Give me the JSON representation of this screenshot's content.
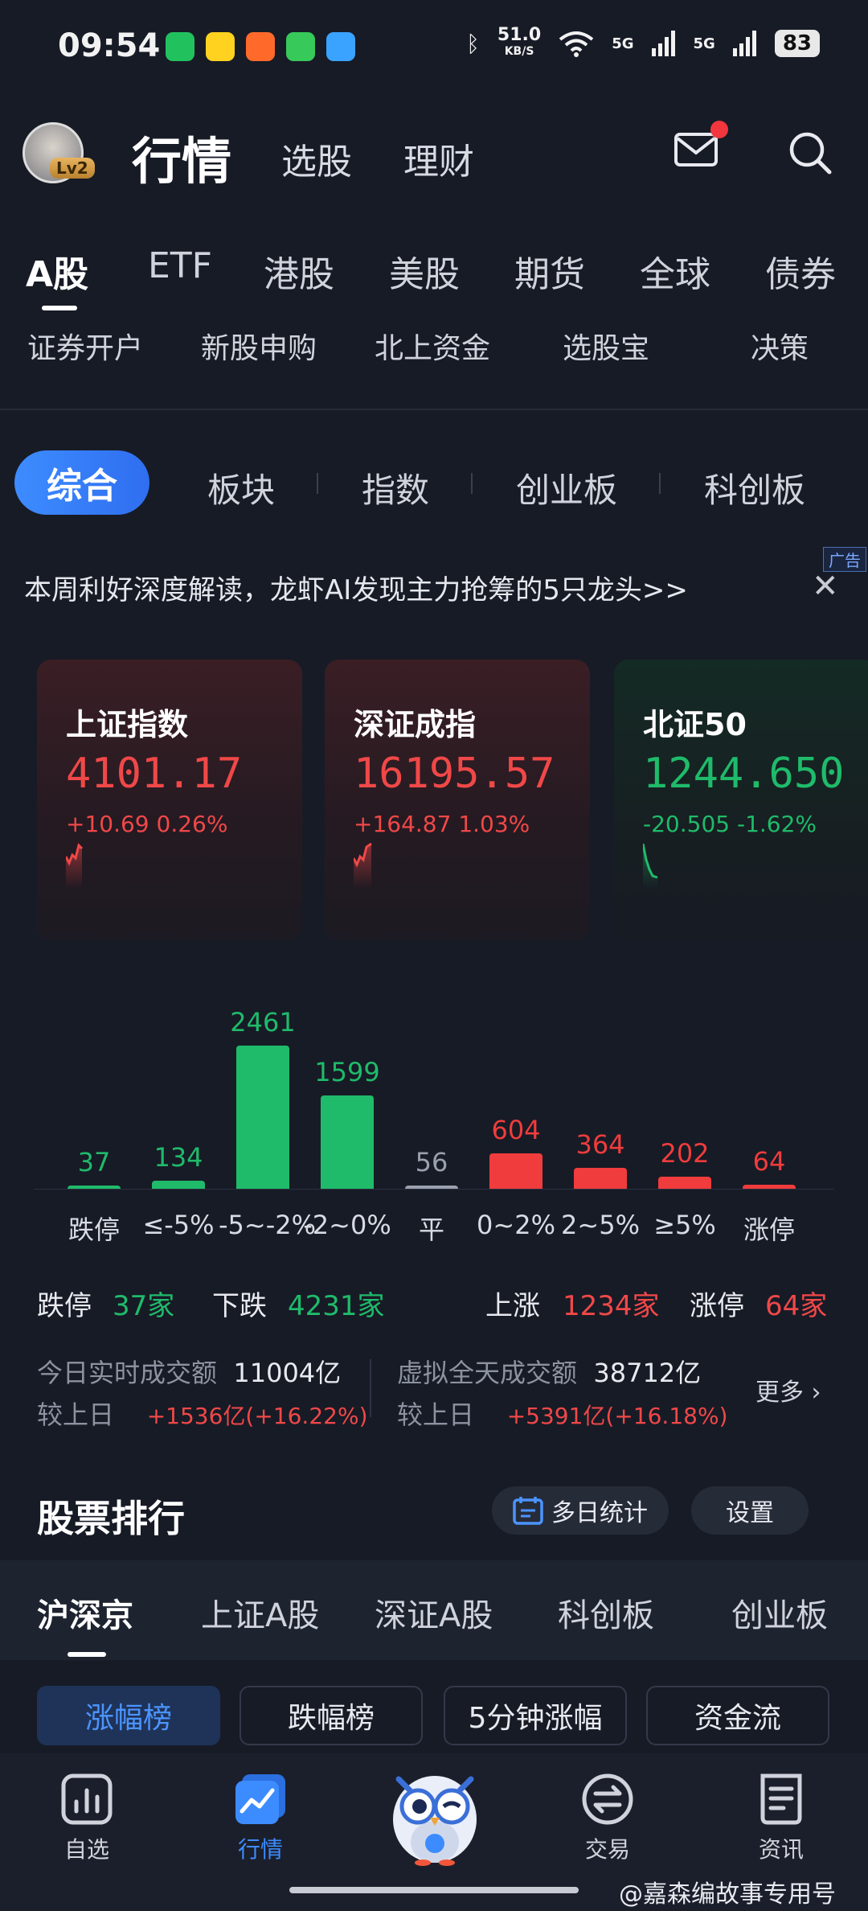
{
  "status_bar": {
    "time": "09:54",
    "net_speed_value": "51.0",
    "net_speed_unit": "KB/S",
    "signal1": "5G",
    "signal2": "5G",
    "battery": "83"
  },
  "header": {
    "level_badge": "Lv2",
    "title": "行情",
    "tab_stock_pick": "选股",
    "tab_finance": "理财"
  },
  "market_tabs": [
    "A股",
    "ETF",
    "港股",
    "美股",
    "期货",
    "全球",
    "债券"
  ],
  "shortcuts": [
    "证券开户",
    "新股申购",
    "北上资金",
    "选股宝",
    "决策"
  ],
  "pill_tabs": [
    "综合",
    "板块",
    "指数",
    "创业板",
    "科创板"
  ],
  "banner": {
    "ad_tag": "广告",
    "text": "本周利好深度解读，龙虾AI发现主力抢筹的5只龙头>>",
    "close": "✕"
  },
  "index_cards": [
    {
      "name": "上证指数",
      "value": "4101.17",
      "change": "+10.69  0.26%",
      "direction": "up"
    },
    {
      "name": "深证成指",
      "value": "16195.57",
      "change": "+164.87  1.03%",
      "direction": "up"
    },
    {
      "name": "北证50",
      "value": "1244.650",
      "change": "-20.505  -1.62%",
      "direction": "down"
    }
  ],
  "chart_data": {
    "type": "bar",
    "categories": [
      "跌停",
      "≤-5%",
      "-5~-2%",
      "-2~0%",
      "平",
      "0~2%",
      "2~5%",
      "≥5%",
      "涨停"
    ],
    "values": [
      37,
      134,
      2461,
      1599,
      56,
      604,
      364,
      202,
      64
    ],
    "colors": [
      "#1fbb6a",
      "#1fbb6a",
      "#1fbb6a",
      "#1fbb6a",
      "#9aa0ad",
      "#f03c3c",
      "#f03c3c",
      "#f03c3c",
      "#f03c3c"
    ],
    "ylim": [
      0,
      2461
    ],
    "grid": false
  },
  "summary": {
    "limit_down_label": "跌停",
    "limit_down_value": "37家",
    "down_label": "下跌",
    "down_value": "4231家",
    "up_label": "上涨",
    "up_value": "1234家",
    "limit_up_label": "涨停",
    "limit_up_value": "64家"
  },
  "turnover": {
    "today_label": "今日实时成交额",
    "today_value": "11004亿",
    "today_cmp_label": "较上日",
    "today_cmp_value": "+1536亿(+16.22%)",
    "virtual_label": "虚拟全天成交额",
    "virtual_value": "38712亿",
    "virtual_cmp_label": "较上日",
    "virtual_cmp_value": "+5391亿(+16.18%)",
    "more": "更多 ›"
  },
  "ranking": {
    "title": "股票排行",
    "multi_day_button": "多日统计",
    "settings_button": "设置",
    "tabs": [
      "沪深京",
      "上证A股",
      "深证A股",
      "科创板",
      "创业板"
    ],
    "chips": [
      "涨幅榜",
      "跌幅榜",
      "5分钟涨幅",
      "资金流"
    ]
  },
  "bottom_nav": [
    "自选",
    "行情",
    "交易",
    "资讯"
  ],
  "watermark": "@嘉森编故事专用号",
  "accent_color": "#3d8cff",
  "up_color": "#f04848",
  "down_color": "#1fbb6a"
}
